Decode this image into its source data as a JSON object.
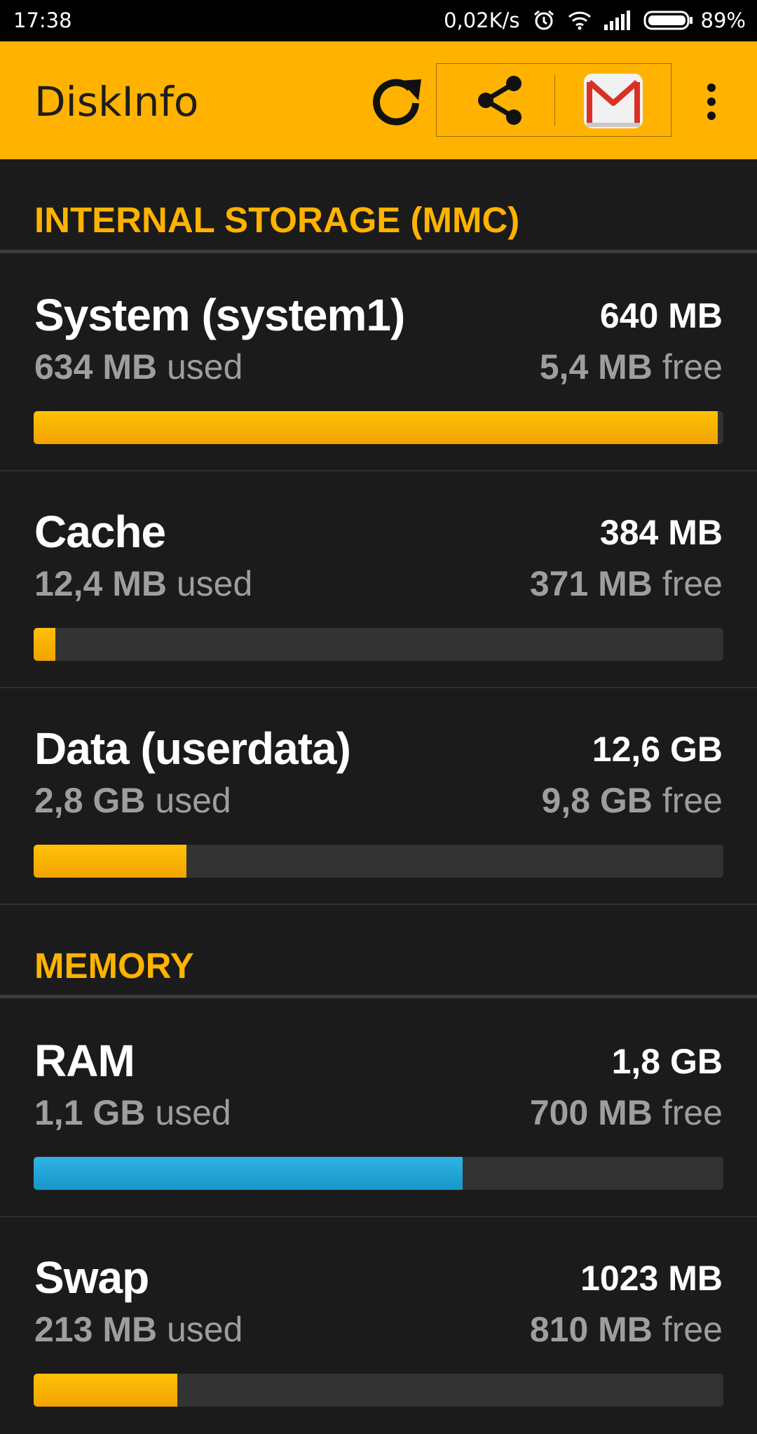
{
  "status_bar": {
    "time": "17:38",
    "net_speed": "0,02K/s",
    "battery": "89%",
    "icons": [
      "alarm-icon",
      "wifi-icon",
      "signal-icon",
      "battery-icon"
    ]
  },
  "app_bar": {
    "title": "DiskInfo",
    "accent_color": "#ffb300",
    "icons": [
      "refresh-icon",
      "share-icon",
      "gmail-icon",
      "more-vert-icon"
    ]
  },
  "sections": {
    "internal": {
      "title": "INTERNAL STORAGE (MMC)",
      "items": [
        {
          "name": "System (system1)",
          "total": "640 MB",
          "used_value": "634 MB",
          "used_label": "used",
          "free_value": "5,4 MB",
          "free_label": "free",
          "fill_percent": 99.2,
          "color": "orange"
        },
        {
          "name": "Cache",
          "total": "384 MB",
          "used_value": "12,4 MB",
          "used_label": "used",
          "free_value": "371 MB",
          "free_label": "free",
          "fill_percent": 3.2,
          "color": "orange"
        },
        {
          "name": "Data (userdata)",
          "total": "12,6 GB",
          "used_value": "2,8 GB",
          "used_label": "used",
          "free_value": "9,8 GB",
          "free_label": "free",
          "fill_percent": 22.2,
          "color": "orange"
        }
      ]
    },
    "memory": {
      "title": "MEMORY",
      "items": [
        {
          "name": "RAM",
          "total": "1,8 GB",
          "used_value": "1,1 GB",
          "used_label": "used",
          "free_value": "700 MB",
          "free_label": "free",
          "fill_percent": 62.2,
          "color": "blue"
        },
        {
          "name": "Swap",
          "total": "1023 MB",
          "used_value": "213 MB",
          "used_label": "used",
          "free_value": "810 MB",
          "free_label": "free",
          "fill_percent": 20.8,
          "color": "orange"
        }
      ]
    }
  }
}
